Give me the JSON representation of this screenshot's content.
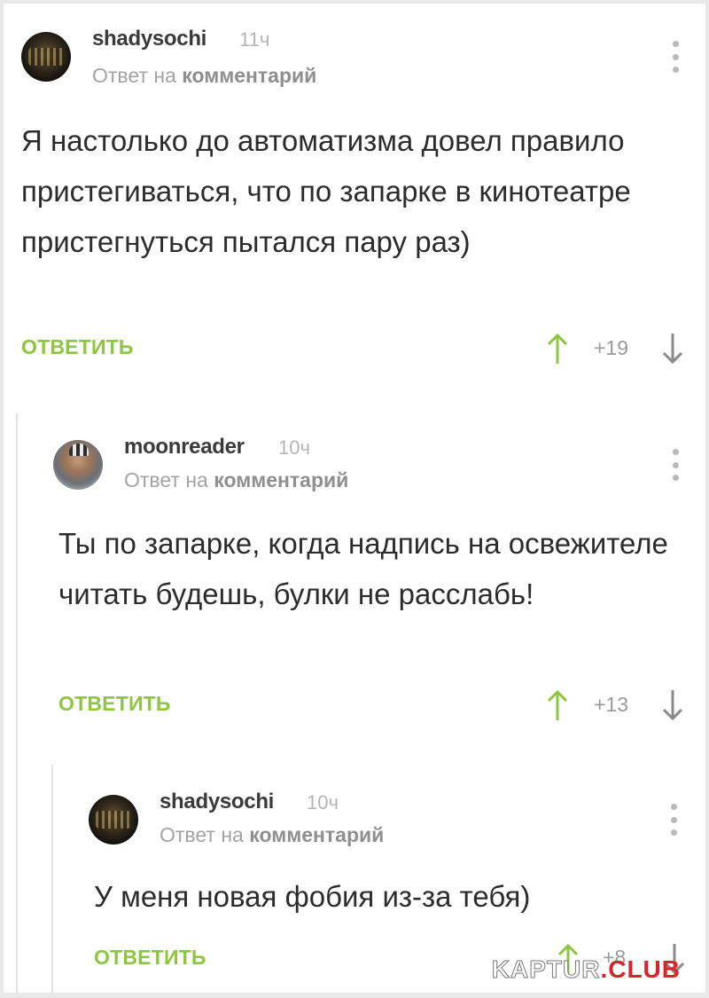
{
  "comments": [
    {
      "username": "shadysochi",
      "time": "11ч",
      "reply_prefix": "Ответ на",
      "reply_target": "комментарий",
      "text": "Я настолько до автоматизма довел правило пристегиваться, что по запарке в кинотеатре пристегнуться пытался пару раз)",
      "reply_label": "ОТВЕТИТЬ",
      "score": "+19",
      "avatar": "dark-avatar"
    },
    {
      "username": "moonreader",
      "time": "10ч",
      "reply_prefix": "Ответ на",
      "reply_target": "комментарий",
      "text": "Ты по запарке, когда надпись на освежителе читать будешь, булки не расслабь!",
      "reply_label": "ОТВЕТИТЬ",
      "score": "+13",
      "avatar": "face-avatar"
    },
    {
      "username": "shadysochi",
      "time": "10ч",
      "reply_prefix": "Ответ на",
      "reply_target": "комментарий",
      "text": "У меня новая фобия из-за тебя)",
      "reply_label": "ОТВЕТИТЬ",
      "score": "+8",
      "avatar": "dark-avatar"
    }
  ],
  "watermark": {
    "part1": "KAPTUR",
    "part2": ".CLUB"
  },
  "colors": {
    "accent": "#8dc63f",
    "up_arrow": "#8dc63f",
    "down_arrow": "#8a8a8a"
  }
}
